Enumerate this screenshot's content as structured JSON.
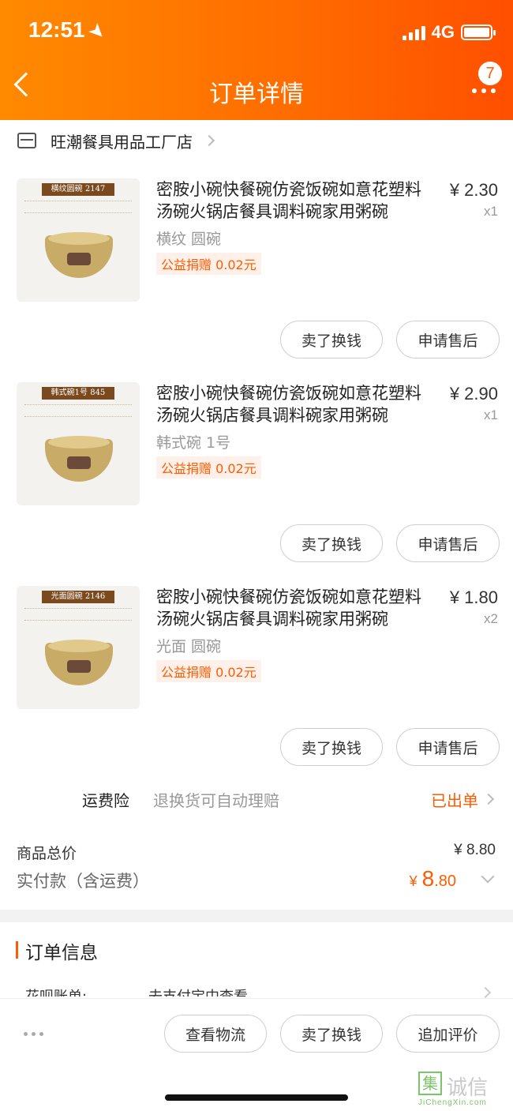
{
  "status_bar": {
    "time": "12:51",
    "network": "4G"
  },
  "header": {
    "title": "订单详情",
    "badge_count": "7"
  },
  "shop": {
    "name": "旺潮餐具用品工厂店"
  },
  "items": [
    {
      "title": "密胺小碗快餐碗仿瓷饭碗如意花塑料汤碗火锅店餐具调料碗家用粥碗",
      "price": "¥ 2.30",
      "quantity": "x1",
      "variant": "横纹 圆碗",
      "donation": "公益捐赠 0.02元",
      "thumb_tag": "横纹圆碗 2147",
      "btn_sell": "卖了换钱",
      "btn_aftersale": "申请售后"
    },
    {
      "title": "密胺小碗快餐碗仿瓷饭碗如意花塑料汤碗火锅店餐具调料碗家用粥碗",
      "price": "¥ 2.90",
      "quantity": "x1",
      "variant": "韩式碗 1号",
      "donation": "公益捐赠 0.02元",
      "thumb_tag": "韩式碗1号 845",
      "btn_sell": "卖了换钱",
      "btn_aftersale": "申请售后"
    },
    {
      "title": "密胺小碗快餐碗仿瓷饭碗如意花塑料汤碗火锅店餐具调料碗家用粥碗",
      "price": "¥ 1.80",
      "quantity": "x2",
      "variant": "光面 圆碗",
      "donation": "公益捐赠 0.02元",
      "thumb_tag": "光面圆碗 2146",
      "btn_sell": "卖了换钱",
      "btn_aftersale": "申请售后"
    }
  ],
  "insurance": {
    "label": "运费险",
    "description": "退换货可自动理赔",
    "status": "已出单"
  },
  "totals": {
    "goods_label": "商品总价",
    "goods_value": "¥ 8.80",
    "paid_label": "实付款（含运费）",
    "paid_currency": "¥",
    "paid_integer": "8",
    "paid_decimal": ".80"
  },
  "order_info": {
    "title": "订单信息",
    "huabei_label": "花呗账单:",
    "huabei_value": "去支付宝中查看"
  },
  "bottom_bar": {
    "btn_logistics": "查看物流",
    "btn_sell": "卖了换钱",
    "btn_review": "追加评价"
  },
  "watermark": {
    "box": "集",
    "text": "诚信",
    "sub": "JiChengXin.com"
  },
  "colors": {
    "accent": "#ff5b00",
    "header_start": "#ff8a00",
    "header_end": "#ff4f00"
  }
}
